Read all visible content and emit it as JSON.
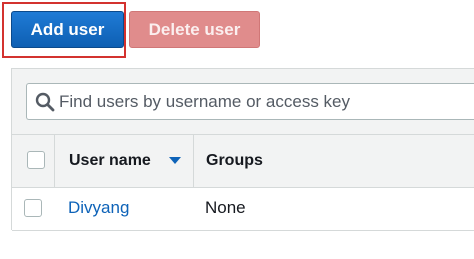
{
  "toolbar": {
    "add_user_label": "Add user",
    "delete_user_label": "Delete user"
  },
  "search": {
    "placeholder": "Find users by username or access key",
    "value": ""
  },
  "table": {
    "columns": [
      "User name",
      "Groups"
    ],
    "sort_column": "User name",
    "sort_direction": "descending",
    "rows": [
      {
        "username": "Divyang",
        "groups": "None"
      }
    ]
  },
  "colors": {
    "primary_button": "#0e5fb3",
    "disabled_danger_button": "#e08c8c",
    "link": "#0e63b8",
    "highlight": "#d3322f"
  }
}
